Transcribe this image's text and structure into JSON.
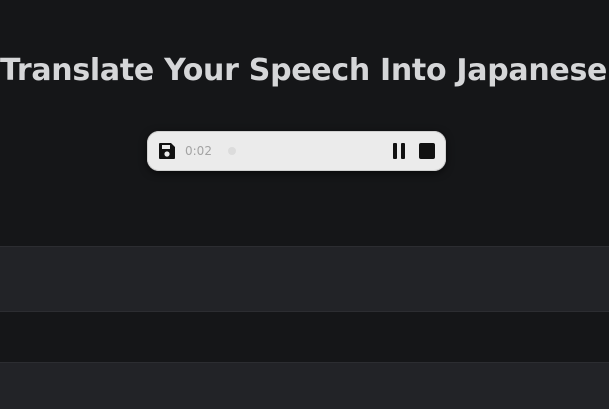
{
  "header": {
    "title": "Translate Your Speech Into Japanese"
  },
  "recorder": {
    "timer": "0:02",
    "save_icon": "floppy-disk-icon",
    "pause_icon": "pause-icon",
    "stop_icon": "stop-icon",
    "background_color": "#ebebeb"
  },
  "theme": {
    "page_background": "#151618",
    "band_background": "#222327",
    "title_color": "#d5d6d8"
  }
}
